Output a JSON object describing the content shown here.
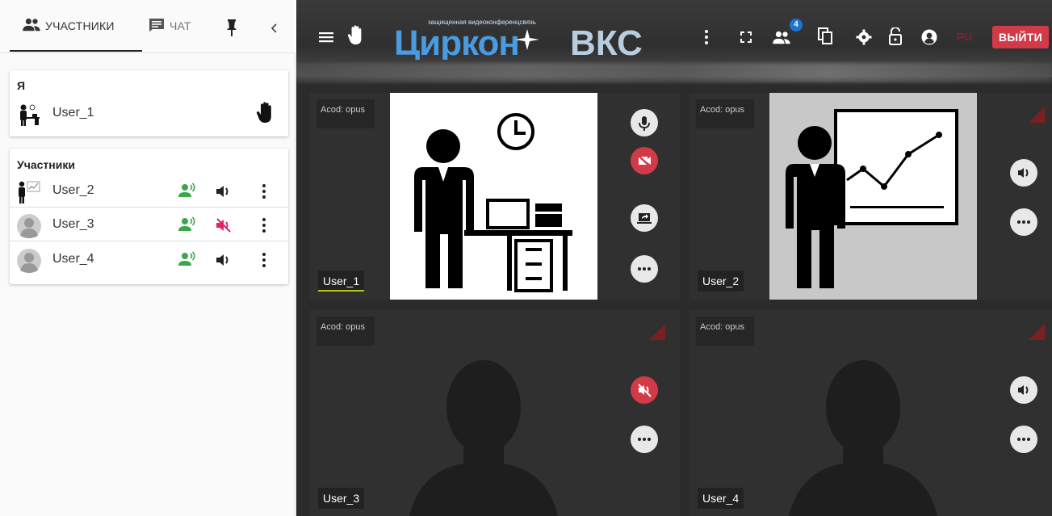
{
  "left_panel": {
    "tabs": [
      {
        "label": "Участники",
        "icon": "people-icon"
      },
      {
        "label": "Чат",
        "icon": "chat-icon"
      }
    ],
    "pin_icon": "pin-icon",
    "collapse_icon": "chevron-left-icon",
    "me_section": {
      "title": "Я",
      "user": {
        "name": "User_1",
        "hand_raised": true
      }
    },
    "participants_section": {
      "title": "Участники",
      "users": [
        {
          "name": "User_2",
          "mic": "on",
          "speaker": "on"
        },
        {
          "name": "User_3",
          "mic": "on",
          "speaker": "muted"
        },
        {
          "name": "User_4",
          "mic": "on",
          "speaker": "on"
        }
      ]
    }
  },
  "topbar": {
    "logo_tagline": "защищенная видеоконференцсвязь",
    "logo_text_main": "Циркон",
    "logo_text_suffix": "ВКС",
    "participants_badge": "4",
    "lang": "RU",
    "exit_label": "ВЫЙТИ",
    "colors": {
      "exit": "#d23a47",
      "lang": "#a31b33",
      "badge": "#1e73d8"
    }
  },
  "tiles": [
    {
      "codec": "Acod: opus",
      "user": "User_1",
      "image": "office-worker-desk"
    },
    {
      "codec": "Acod: opus",
      "user": "User_2",
      "image": "presenter-chart"
    },
    {
      "codec": "Acod: opus",
      "user": "User_3",
      "image": "silhouette"
    },
    {
      "codec": "Acod: opus",
      "user": "User_4",
      "image": "silhouette"
    }
  ]
}
